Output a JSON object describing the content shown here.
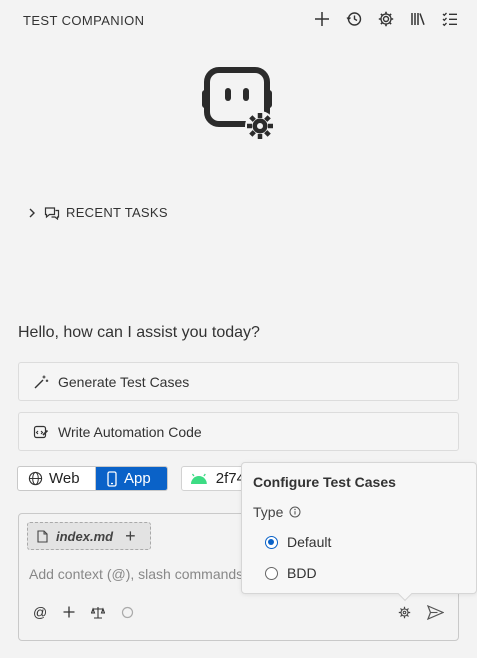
{
  "header": {
    "title": "TEST COMPANION",
    "icons": [
      "plus-icon",
      "history-icon",
      "gear-icon",
      "library-icon",
      "checklist-icon"
    ]
  },
  "recent_tasks": {
    "label": "RECENT TASKS"
  },
  "greeting": "Hello, how can I assist you today?",
  "actions": [
    {
      "label": "Generate Test Cases",
      "icon": "magic-wand-icon"
    },
    {
      "label": "Write Automation Code",
      "icon": "code-edit-icon"
    }
  ],
  "platform": {
    "options": [
      {
        "label": "Web",
        "icon": "globe-icon",
        "selected": false
      },
      {
        "label": "App",
        "icon": "phone-icon",
        "selected": true
      }
    ],
    "device_id": "2f74"
  },
  "composer": {
    "file_chip": "index.md",
    "placeholder": "Add context (@), slash commands",
    "toolbar": {
      "at": "@"
    }
  },
  "config_popover": {
    "title": "Configure Test Cases",
    "type_label": "Type",
    "options": [
      {
        "label": "Default",
        "selected": true
      },
      {
        "label": "BDD",
        "selected": false
      }
    ]
  },
  "colors": {
    "accent": "#0a62c8",
    "android": "#3ddc84",
    "background": "#f3f3f3"
  }
}
